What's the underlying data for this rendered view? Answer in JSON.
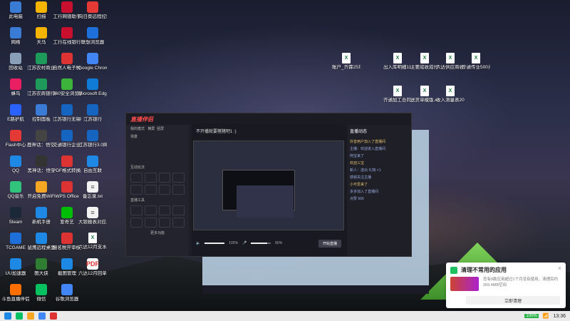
{
  "desktop_icons": [
    {
      "label": "此电脑",
      "type": "app",
      "color": "#3a7bd5"
    },
    {
      "label": "扫描",
      "type": "app",
      "color": "#f5b400"
    },
    {
      "label": "工行网银助手",
      "type": "app",
      "color": "#c8102e"
    },
    {
      "label": "向日葵远程控制",
      "type": "app",
      "color": "#e53935"
    },
    {
      "label": "网络",
      "type": "app",
      "color": "#3a7bd5"
    },
    {
      "label": "天马",
      "type": "app",
      "color": "#f5b400"
    },
    {
      "label": "工行在线银行",
      "type": "app",
      "color": "#c8102e"
    },
    {
      "label": "联想浏览器",
      "type": "app",
      "color": "#1e6fd9"
    },
    {
      "label": "回收站",
      "type": "app",
      "color": "#8aa0b8"
    },
    {
      "label": "江苏农村商业银行网银...",
      "type": "app",
      "color": "#1e9b5a"
    },
    {
      "label": "自然人电子税务局（扣缴...",
      "type": "app",
      "color": "#d33"
    },
    {
      "label": "Google Chrome",
      "type": "app",
      "color": "#4285f4"
    },
    {
      "label": "蜂鸟",
      "type": "app",
      "color": "#e91e63"
    },
    {
      "label": "江苏农商银行网银二代U5...",
      "type": "app",
      "color": "#1e9b5a"
    },
    {
      "label": "360安全浏览器",
      "type": "app",
      "color": "#3cb43c"
    },
    {
      "label": "Microsoft Edge",
      "type": "app",
      "color": "#0f7bd6"
    },
    {
      "label": "E路护航",
      "type": "app",
      "color": "#2962ff"
    },
    {
      "label": "控制面板",
      "type": "app",
      "color": "#3a7bd5"
    },
    {
      "label": "江苏银行无锡UKey用户...",
      "type": "app",
      "color": "#1565c0"
    },
    {
      "label": "江苏银行",
      "type": "app",
      "color": "#1565c0"
    },
    {
      "label": "Flash中心",
      "type": "app",
      "color": "#e53935"
    },
    {
      "label": "鹿神话：悟空性能测试工具",
      "type": "app",
      "color": "#444"
    },
    {
      "label": "交通银行企业网银",
      "type": "app",
      "color": "#1565c0"
    },
    {
      "label": "江苏银行3.0网银助手",
      "type": "app",
      "color": "#1565c0"
    },
    {
      "label": "QQ",
      "type": "app",
      "color": "#1e88e5"
    },
    {
      "label": "黑神话：悟空",
      "type": "app",
      "color": "#333"
    },
    {
      "label": "PDF格式转换器",
      "type": "app",
      "color": "#d33"
    },
    {
      "label": "自由互联",
      "type": "app",
      "color": "#1e88e5"
    },
    {
      "label": "QQ音乐",
      "type": "app",
      "color": "#31c27c"
    },
    {
      "label": "开启免费WiFi",
      "type": "app",
      "color": "#f5a623"
    },
    {
      "label": "WPS Office",
      "type": "app",
      "color": "#d33"
    },
    {
      "label": "备忘录.txt",
      "type": "txt",
      "color": "#555"
    },
    {
      "label": "Steam",
      "type": "app",
      "color": "#1b2838"
    },
    {
      "label": "新机手册",
      "type": "app",
      "color": "#1e88e5"
    },
    {
      "label": "爱奇艺",
      "type": "app",
      "color": "#00be06"
    },
    {
      "label": "大银报表对应.txt",
      "type": "txt",
      "color": "#555"
    },
    {
      "label": "TCGAME",
      "type": "app",
      "color": "#1e6fd9"
    },
    {
      "label": "鼠鹰远程桌面",
      "type": "app",
      "color": "#1e88e5"
    },
    {
      "label": "报名税开审核处理工具V2",
      "type": "app",
      "color": "#d33"
    },
    {
      "label": "六达12月支水.xls",
      "type": "file",
      "color": "#1e7b3f"
    },
    {
      "label": "UU加速器",
      "type": "app",
      "color": "#1e88e5"
    },
    {
      "label": "图大侠",
      "type": "app",
      "color": "#2e7d32"
    },
    {
      "label": "截图管理",
      "type": "app",
      "color": "#1e88e5"
    },
    {
      "label": "六达12月回单.pdf",
      "type": "pdf",
      "color": "#d33"
    },
    {
      "label": "斗鱼直播伴侣",
      "type": "app",
      "color": "#ff6f00"
    },
    {
      "label": "微信",
      "type": "app",
      "color": "#07c160"
    },
    {
      "label": "谷歌浏览器",
      "type": "app",
      "color": "#4285f4"
    }
  ],
  "right_files": [
    {
      "label": "账户_齐霖25年12月对...",
      "type": "file"
    },
    {
      "label": "出入库明细11月表.xls",
      "type": "file"
    },
    {
      "label": "主要成收成付明细.xlsx",
      "type": "file"
    },
    {
      "label": "六达供应商收款汇总明细表",
      "type": "file"
    },
    {
      "label": "齐通传业500元（委托加...",
      "type": "file"
    },
    {
      "label": "齐通加工合同（1.44）.xlsx",
      "type": "file"
    },
    {
      "label": "送货单模版.xlsx",
      "type": "file"
    },
    {
      "label": "收入测量表2025年6月...",
      "type": "file"
    }
  ],
  "live_app": {
    "logo": "直播伴侣",
    "left_header": "我的模式",
    "left_tabs": [
      "横屏",
      "竖屏"
    ],
    "scene_label": "场景",
    "interactive_label": "互动玩法",
    "tools_label": "直播工具",
    "more_label": "更多功能",
    "stream_title": "不开播就要猪猪吧1 :)",
    "volume_pct": "100%",
    "mic_pct": "80%",
    "start_label": "开始直播",
    "right_header": "直播动态",
    "chat": [
      "抖音用户加入了直播间",
      "主播：欢迎进入直播间",
      "阿宝来了",
      "欢迎三宝",
      "新人：送出 礼物 ×1",
      "感谢关注主播",
      "小可爱来了",
      "多多加入了直播间",
      "点赞 666"
    ]
  },
  "notification": {
    "title": "清理不常用的应用",
    "desc": "您有8款应用超过1个月没有使用，清理后约269.4MB空间",
    "button": "立即清理"
  },
  "taskbar": {
    "battery": "100%",
    "time": "13:36"
  },
  "colors": {
    "accent": "#ff4d4f",
    "notify": "#1ec15f"
  }
}
